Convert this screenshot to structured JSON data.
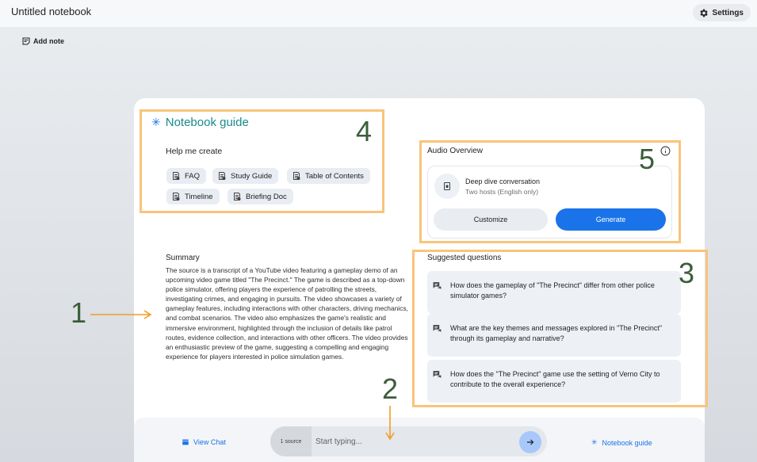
{
  "header": {
    "title": "Untitled notebook",
    "settings_label": "Settings"
  },
  "toolbar": {
    "add_note_label": "Add note"
  },
  "guide": {
    "title": "Notebook guide",
    "help_label": "Help me create",
    "chips": [
      "FAQ",
      "Study Guide",
      "Table of Contents",
      "Timeline",
      "Briefing Doc"
    ]
  },
  "audio": {
    "title": "Audio Overview",
    "item_title": "Deep dive conversation",
    "item_subtitle": "Two hosts (English only)",
    "customize_label": "Customize",
    "generate_label": "Generate"
  },
  "summary": {
    "title": "Summary",
    "text": "The source is a transcript of a YouTube video featuring a gameplay demo of an upcoming video game titled \"The Precinct.\" The game is described as a top-down police simulator, offering players the experience of patrolling the streets, investigating crimes, and engaging in pursuits. The video showcases a variety of gameplay features, including interactions with other characters, driving mechanics, and combat scenarios. The video also emphasizes the game's realistic and immersive environment, highlighted through the inclusion of details like patrol routes, evidence collection, and interactions with other officers. The video provides an enthusiastic preview of the game, suggesting a compelling and engaging experience for players interested in police simulation games."
  },
  "questions": {
    "title": "Suggested questions",
    "items": [
      "How does the gameplay of \"The Precinct\" differ from other police simulator games?",
      "What are the key themes and messages explored in \"The Precinct\" through its gameplay and narrative?",
      "How does the \"The Precinct\" game use the setting of Verno City to contribute to the overall experience?"
    ]
  },
  "chat": {
    "view_chat_label": "View Chat",
    "source_count": "1 source",
    "placeholder": "Start typing...",
    "notebook_guide_label": "Notebook guide"
  },
  "annotations": [
    "1",
    "2",
    "3",
    "4",
    "5"
  ],
  "colors": {
    "accent": "#1a73e8",
    "annotation_box": "#f9c47a",
    "annotation_number": "#3c5d3a",
    "guide_title": "#1a8a8a"
  }
}
